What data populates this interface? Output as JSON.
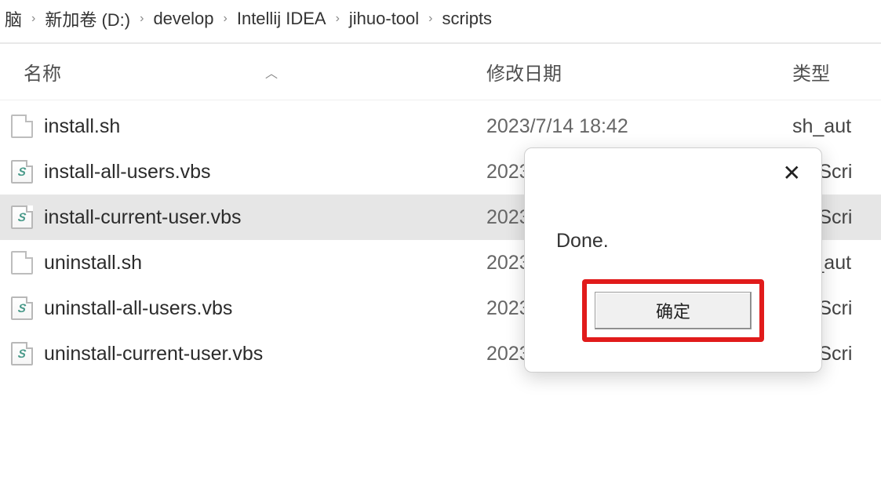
{
  "breadcrumb": {
    "items": [
      "脑",
      "新加卷 (D:)",
      "develop",
      "Intellij IDEA",
      "jihuo-tool",
      "scripts"
    ]
  },
  "columns": {
    "name": "名称",
    "date": "修改日期",
    "type": "类型"
  },
  "files": [
    {
      "name": "install.sh",
      "date": "2023/7/14 18:42",
      "type": "sh_aut",
      "iconKind": "blank",
      "selected": false
    },
    {
      "name": "install-all-users.vbs",
      "date": "2023",
      "type": "VBScri",
      "iconKind": "vbs",
      "selected": false
    },
    {
      "name": "install-current-user.vbs",
      "date": "2023",
      "type": "VBScri",
      "iconKind": "vbs",
      "selected": true
    },
    {
      "name": "uninstall.sh",
      "date": "2023",
      "type": "sh_aut",
      "iconKind": "blank",
      "selected": false
    },
    {
      "name": "uninstall-all-users.vbs",
      "date": "2023",
      "type": "VBScri",
      "iconKind": "vbs",
      "selected": false
    },
    {
      "name": "uninstall-current-user.vbs",
      "date": "2023",
      "type": "VBScri",
      "iconKind": "vbs",
      "selected": false
    }
  ],
  "dialog": {
    "message": "Done.",
    "ok_label": "确定"
  }
}
